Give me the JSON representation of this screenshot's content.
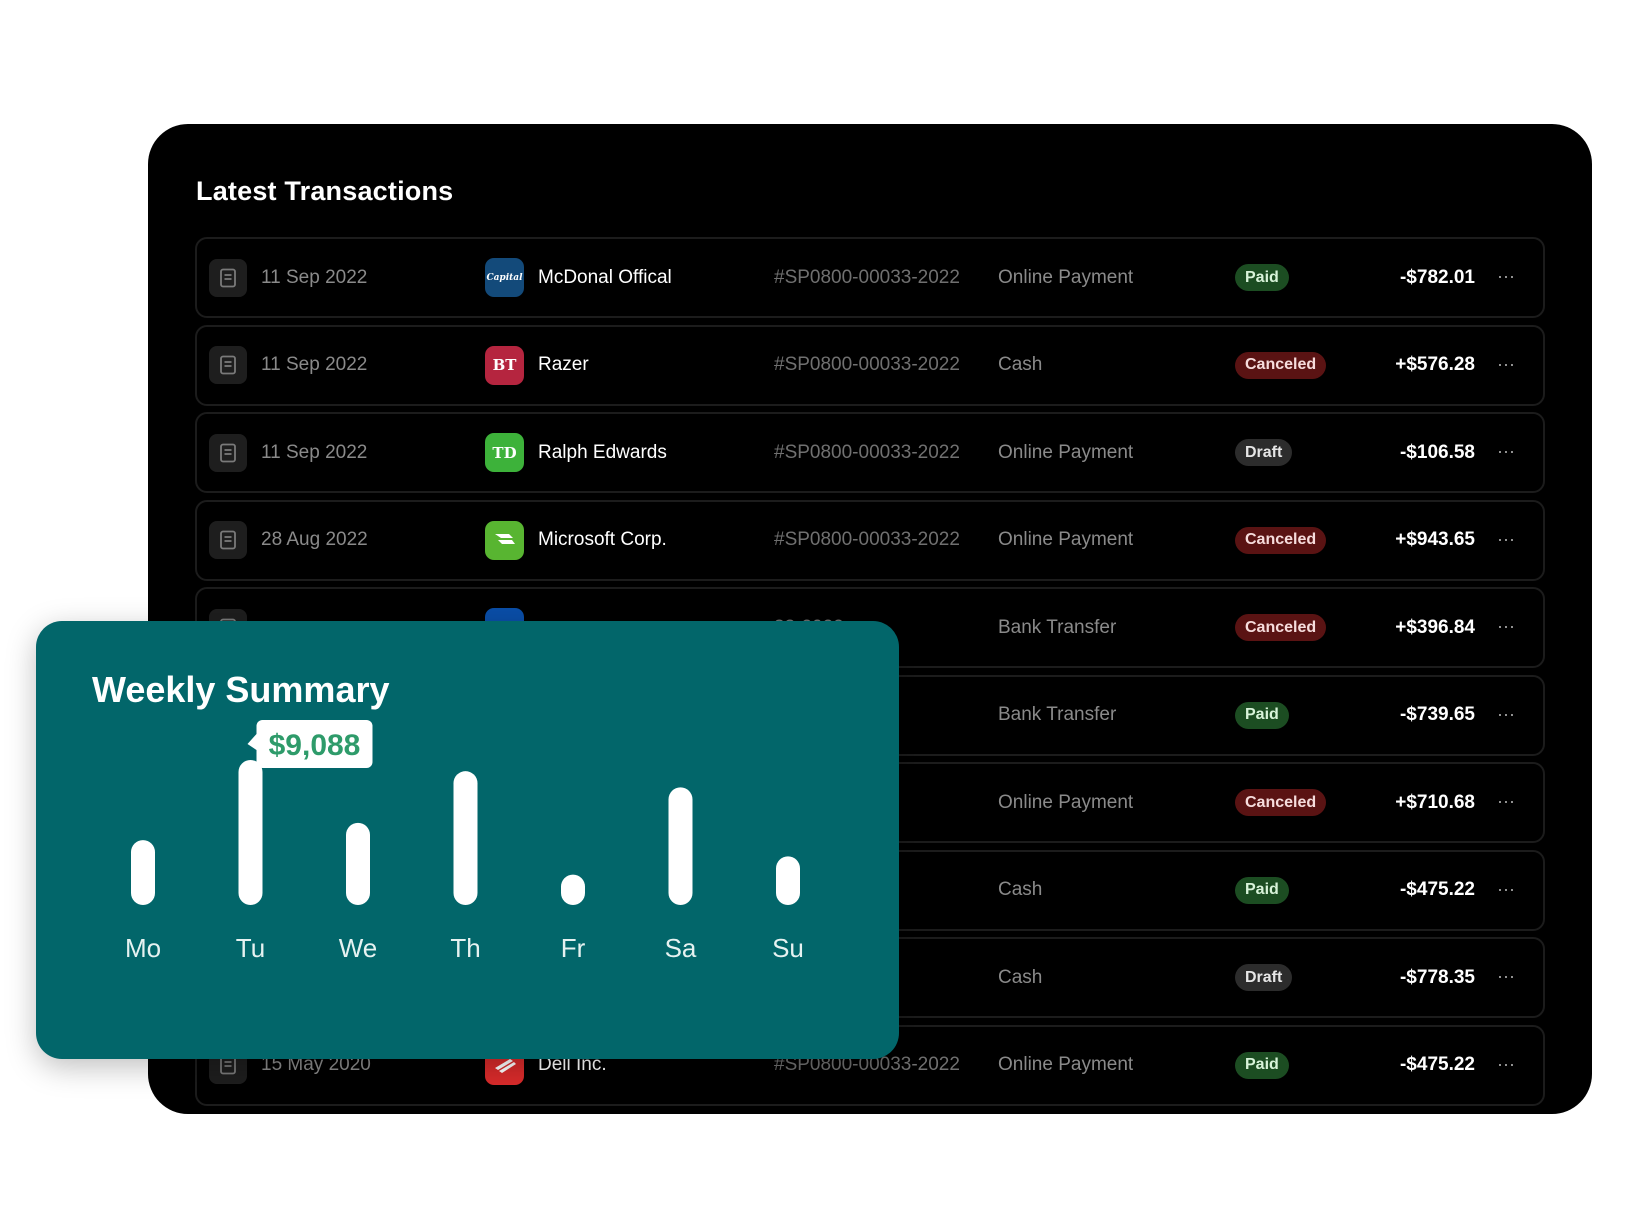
{
  "transactions": {
    "title": "Latest Transactions",
    "rows": [
      {
        "date": "11 Sep 2022",
        "name": "McDonal Offical",
        "logo_text": "Capital",
        "logo_color": "#134a7a",
        "ref": "#SP0800-00033-2022",
        "method": "Online Payment",
        "status": "Paid",
        "status_kind": "paid",
        "amount": "-$782.01"
      },
      {
        "date": "11 Sep 2022",
        "name": "Razer",
        "logo_text": "BT",
        "logo_color": "#b5253f",
        "ref": "#SP0800-00033-2022",
        "method": "Cash",
        "status": "Canceled",
        "status_kind": "canceled",
        "amount": "+$576.28"
      },
      {
        "date": "11 Sep 2022",
        "name": "Ralph Edwards",
        "logo_text": "TD",
        "logo_color": "#3db23a",
        "ref": "#SP0800-00033-2022",
        "method": "Online Payment",
        "status": "Draft",
        "status_kind": "draft",
        "amount": "-$106.58"
      },
      {
        "date": "28 Aug 2022",
        "name": "Microsoft Corp.",
        "logo_text": "",
        "logo_color": "#58b531",
        "ref": "#SP0800-00033-2022",
        "method": "Online Payment",
        "status": "Canceled",
        "status_kind": "canceled",
        "amount": "+$943.65"
      },
      {
        "date": "",
        "name": "",
        "logo_text": "",
        "logo_color": "#0a4ea8",
        "ref": "33-2022",
        "method": "Bank Transfer",
        "status": "Canceled",
        "status_kind": "canceled",
        "amount": "+$396.84"
      },
      {
        "date": "",
        "name": "",
        "logo_text": "",
        "logo_color": "",
        "ref": "33-2022",
        "method": "Bank Transfer",
        "status": "Paid",
        "status_kind": "paid",
        "amount": "-$739.65"
      },
      {
        "date": "",
        "name": "",
        "logo_text": "",
        "logo_color": "",
        "ref": "33-2022",
        "method": "Online Payment",
        "status": "Canceled",
        "status_kind": "canceled",
        "amount": "+$710.68"
      },
      {
        "date": "",
        "name": "",
        "logo_text": "",
        "logo_color": "",
        "ref": "33-2022",
        "method": "Cash",
        "status": "Paid",
        "status_kind": "paid",
        "amount": "-$475.22"
      },
      {
        "date": "",
        "name": "",
        "logo_text": "",
        "logo_color": "",
        "ref": "33-2022",
        "method": "Cash",
        "status": "Draft",
        "status_kind": "draft",
        "amount": "-$778.35"
      },
      {
        "date": "15 May 2020",
        "name": "Dell Inc.",
        "logo_text": "",
        "logo_color": "#d92b2b",
        "ref": "#SP0800-00033-2022",
        "method": "Online Payment",
        "status": "Paid",
        "status_kind": "paid",
        "amount": "-$475.22"
      }
    ]
  },
  "weekly_summary": {
    "title": "Weekly Summary"
  },
  "chart_data": {
    "type": "bar",
    "title": "Weekly Summary",
    "categories": [
      "Mo",
      "Tu",
      "We",
      "Th",
      "Fr",
      "Sa",
      "Su"
    ],
    "values": [
      3200,
      7150,
      4050,
      6600,
      1500,
      5800,
      2400
    ],
    "highlight": {
      "category": "Tu",
      "label": "$9,088"
    },
    "colors": {
      "bar": "#ffffff",
      "background": "#02666a",
      "tooltip_text": "#2e9b6a"
    }
  }
}
